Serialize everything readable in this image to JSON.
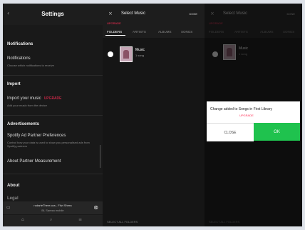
{
  "settings": {
    "title": "Settings",
    "sections": [
      {
        "header": "Notifications",
        "title": "Notifications",
        "subtitle": "Choose which notifications to receive"
      },
      {
        "header": "Import",
        "title": "Import your music",
        "badge": "UPGRADE",
        "subtitle": "Add your music from the device"
      },
      {
        "header": "Advertisements",
        "title": "Spotify Ad Partner Preferences",
        "subtitle": "Control how your data is used to show you personalised ads from Spotify partners"
      },
      {
        "title": "About Partner Measurement"
      },
      {
        "header": "About"
      },
      {
        "header": "Legal"
      }
    ],
    "mini_player": {
      "line1": "rodarteThere.ocs - Fitzi Shera",
      "line2": "BL Samsa mobile"
    },
    "colors": {
      "accent_red": "#ff2d55",
      "green": "#1fc24e"
    }
  },
  "music": {
    "title": "Select Music",
    "action": "DONE",
    "label": "UPGRADE",
    "tabs": [
      "FOLDERS",
      "ARTISTS",
      "ALBUMS",
      "SONGS"
    ],
    "row": {
      "title": "Music",
      "subtitle": "1 song"
    },
    "bottom": "SELECT ALL FOLDERS"
  },
  "dialog": {
    "message": "Change added to Songs in First Library",
    "sub": "UPGRADE",
    "cancel": "CLOSE",
    "ok": "OK",
    "bottom": "SELECT ALL FOLDERS"
  }
}
